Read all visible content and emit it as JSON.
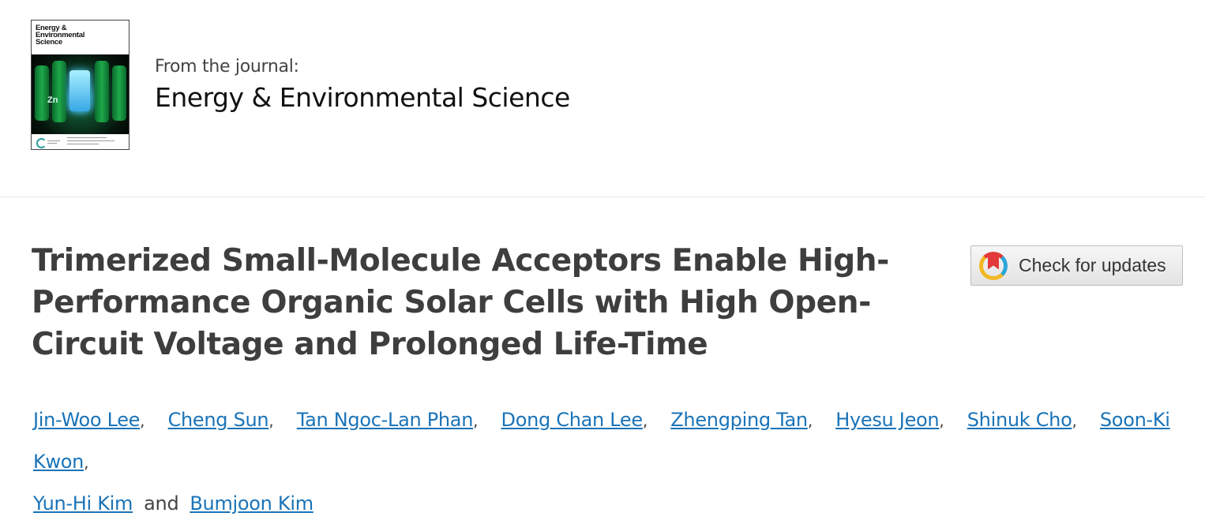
{
  "journal": {
    "from_label": "From the journal:",
    "name": "Energy & Environmental Science",
    "cover_title_lines": [
      "Energy &",
      "Environmental",
      "Science"
    ],
    "cover_element": "Zn"
  },
  "article": {
    "title": "Trimerized Small-Molecule Acceptors Enable High-Performance Organic Solar Cells with High Open-Circuit Voltage and Prolonged Life-Time"
  },
  "check_updates": {
    "label": "Check for updates",
    "icon": "crossmark-icon",
    "colors": {
      "red": "#e23a3a",
      "yellow": "#f2b824",
      "blue": "#2ba6d8"
    }
  },
  "authors": {
    "list": [
      "Jin-Woo Lee",
      "Cheng Sun",
      "Tan Ngoc-Lan Phan",
      "Dong Chan Lee",
      "Zhengping Tan",
      "Hyesu Jeon",
      "Shinuk Cho",
      "Soon-Ki Kwon",
      "Yun-Hi Kim",
      "Bumjoon Kim"
    ],
    "separator": ",",
    "conjunction": "and"
  },
  "colors": {
    "link": "#1a73b8",
    "title": "#3e3e3e",
    "divider": "#e5e5e5"
  }
}
